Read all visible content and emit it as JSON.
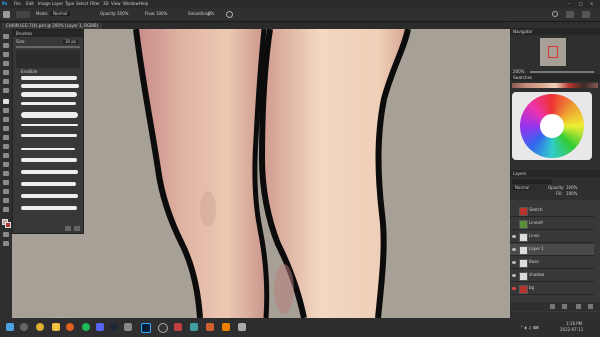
{
  "menu": {
    "items": [
      "File",
      "Edit",
      "Image",
      "Layer",
      "Type",
      "Select",
      "Filter",
      "3D",
      "View",
      "Window",
      "Help"
    ]
  },
  "options": {
    "mode_label": "Mode:",
    "mode_value": "Normal",
    "opacity_label": "Opacity:",
    "opacity_value": "100%",
    "flow_label": "Flow:",
    "flow_value": "100%",
    "smoothing_label": "Smoothing:",
    "smoothing_value": "0%"
  },
  "document": {
    "tab_title": "CHAIN LEG 7(4).psd @ 200% (Layer 1, RGB/8)"
  },
  "brushes_panel": {
    "title": "Brushes",
    "size_label": "Size:",
    "size_value": "30 px",
    "group_label": "Erodible"
  },
  "navigator": {
    "title": "Navigator",
    "zoom": "200%"
  },
  "swatches": {
    "title": "Swatches"
  },
  "layers_panel": {
    "title": "Layers",
    "blend": "Normal",
    "opacity_label": "Opacity:",
    "opacity_value": "100%",
    "fill_label": "Fill:",
    "fill_value": "100%",
    "layers": [
      {
        "name": "Sketch",
        "color": "#b8342f"
      },
      {
        "name": "Lineart",
        "color": "#5a8f3c"
      },
      {
        "name": "Lines",
        "color": "#dcdcdc"
      },
      {
        "name": "Layer 1",
        "color": "#dcdcdc"
      },
      {
        "name": "Base",
        "color": "#dcdcdc"
      },
      {
        "name": "shadow",
        "color": "#dcdcdc"
      },
      {
        "name": "bg",
        "color": "#b8342f"
      }
    ]
  },
  "status": {
    "zoom": "200%",
    "doc": "Doc: 60.6M/133.2M"
  },
  "taskbar": {
    "time": "3:16 PM",
    "date": "2022-07-11"
  },
  "colors": {
    "canvas_bg": "#a7a096",
    "skin_light": "#f1d6c0",
    "skin_shadow": "#c98e8a",
    "outline": "#0c0c0c"
  }
}
